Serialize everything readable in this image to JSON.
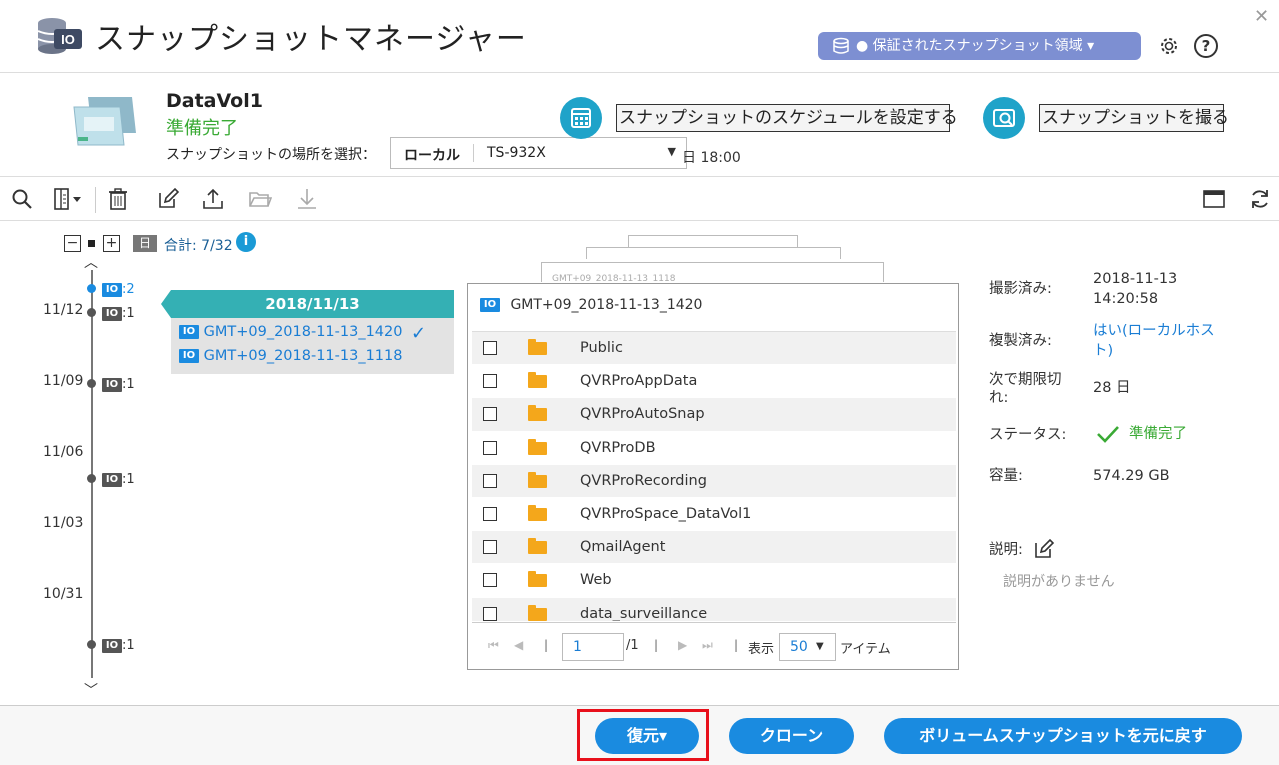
{
  "window": {
    "title": "スナップショットマネージャー",
    "protected_area_label": "● 保証されたスナップショット領域 ▾",
    "close": "✕",
    "help": "?"
  },
  "volume": {
    "name": "DataVol1",
    "status": "準備完了",
    "location_label": "スナップショットの場所を選択：",
    "location_value": "ローカル",
    "device_value": "TS-932X",
    "obscured_time": "日 18:00",
    "schedule_button": "スナップショットのスケジュールを設定する",
    "take_button": "スナップショットを撮る"
  },
  "timeline": {
    "collapse": "−",
    "expand": "+",
    "calendar_badge": "日",
    "total": "合計: 7/32",
    "info": "i",
    "io_label": "IO",
    "dates": [
      "11/12",
      "11/09",
      "11/06",
      "11/03",
      "10/31"
    ],
    "counts": [
      ":2",
      ":1",
      ":1",
      ":1",
      ":1"
    ],
    "up": "︿",
    "down": "﹀"
  },
  "date_card": {
    "date": "2018/11/13",
    "snapshots": [
      "GMT+09_2018-11-13_1420",
      "GMT+09_2018-11-13_1118"
    ],
    "check": "✓"
  },
  "file_panel": {
    "header": "GMT+09_2018-11-13_1420",
    "stack_label": "GMT+09_2018-11-13_1118",
    "folders": [
      "Public",
      "QVRProAppData",
      "QVRProAutoSnap",
      "QVRProDB",
      "QVRProRecording",
      "QVRProSpace_DataVol1",
      "QmailAgent",
      "Web",
      "data_surveillance"
    ],
    "pager": {
      "page": "1",
      "of_pages": "/1",
      "show_label": "表示",
      "per_page": "50",
      "items_label": "アイテム",
      "first": "⏮",
      "prev": "◀",
      "next": "▶",
      "last": "⏭",
      "sep": "|"
    }
  },
  "details": {
    "taken_label": "撮影済み:",
    "taken_value_1": "2018-11-13",
    "taken_value_2": "14:20:58",
    "replicated_label": "複製済み:",
    "replicated_value_1": "はい(ローカルホス",
    "replicated_value_2": "ト)",
    "expire_label_1": "次で期限切",
    "expire_label_2": "れ:",
    "expire_value": "28 日",
    "status_label": "ステータス:",
    "status_value": "準備完了",
    "capacity_label": "容量:",
    "capacity_value": "574.29 GB",
    "description_label": "説明:",
    "description_value": "説明がありません"
  },
  "footer": {
    "restore": "復元▾",
    "clone": "クローン",
    "revert": "ボリュームスナップショットを元に戻す"
  },
  "colors": {
    "accent_blue": "#1a8be0",
    "teal": "#34b0b4",
    "status_green": "#3aaa35",
    "pill_purple": "#7d8fd2",
    "highlight_red": "#e8101b"
  }
}
